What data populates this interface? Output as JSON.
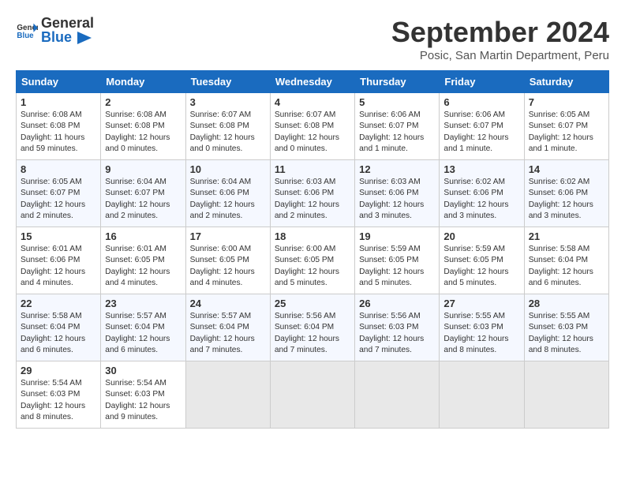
{
  "header": {
    "logo_general": "General",
    "logo_blue": "Blue",
    "month_title": "September 2024",
    "location": "Posic, San Martin Department, Peru"
  },
  "days_of_week": [
    "Sunday",
    "Monday",
    "Tuesday",
    "Wednesday",
    "Thursday",
    "Friday",
    "Saturday"
  ],
  "weeks": [
    [
      {
        "num": "1",
        "info": "Sunrise: 6:08 AM\nSunset: 6:08 PM\nDaylight: 11 hours\nand 59 minutes."
      },
      {
        "num": "2",
        "info": "Sunrise: 6:08 AM\nSunset: 6:08 PM\nDaylight: 12 hours\nand 0 minutes."
      },
      {
        "num": "3",
        "info": "Sunrise: 6:07 AM\nSunset: 6:08 PM\nDaylight: 12 hours\nand 0 minutes."
      },
      {
        "num": "4",
        "info": "Sunrise: 6:07 AM\nSunset: 6:08 PM\nDaylight: 12 hours\nand 0 minutes."
      },
      {
        "num": "5",
        "info": "Sunrise: 6:06 AM\nSunset: 6:07 PM\nDaylight: 12 hours\nand 1 minute."
      },
      {
        "num": "6",
        "info": "Sunrise: 6:06 AM\nSunset: 6:07 PM\nDaylight: 12 hours\nand 1 minute."
      },
      {
        "num": "7",
        "info": "Sunrise: 6:05 AM\nSunset: 6:07 PM\nDaylight: 12 hours\nand 1 minute."
      }
    ],
    [
      {
        "num": "8",
        "info": "Sunrise: 6:05 AM\nSunset: 6:07 PM\nDaylight: 12 hours\nand 2 minutes."
      },
      {
        "num": "9",
        "info": "Sunrise: 6:04 AM\nSunset: 6:07 PM\nDaylight: 12 hours\nand 2 minutes."
      },
      {
        "num": "10",
        "info": "Sunrise: 6:04 AM\nSunset: 6:06 PM\nDaylight: 12 hours\nand 2 minutes."
      },
      {
        "num": "11",
        "info": "Sunrise: 6:03 AM\nSunset: 6:06 PM\nDaylight: 12 hours\nand 2 minutes."
      },
      {
        "num": "12",
        "info": "Sunrise: 6:03 AM\nSunset: 6:06 PM\nDaylight: 12 hours\nand 3 minutes."
      },
      {
        "num": "13",
        "info": "Sunrise: 6:02 AM\nSunset: 6:06 PM\nDaylight: 12 hours\nand 3 minutes."
      },
      {
        "num": "14",
        "info": "Sunrise: 6:02 AM\nSunset: 6:06 PM\nDaylight: 12 hours\nand 3 minutes."
      }
    ],
    [
      {
        "num": "15",
        "info": "Sunrise: 6:01 AM\nSunset: 6:06 PM\nDaylight: 12 hours\nand 4 minutes."
      },
      {
        "num": "16",
        "info": "Sunrise: 6:01 AM\nSunset: 6:05 PM\nDaylight: 12 hours\nand 4 minutes."
      },
      {
        "num": "17",
        "info": "Sunrise: 6:00 AM\nSunset: 6:05 PM\nDaylight: 12 hours\nand 4 minutes."
      },
      {
        "num": "18",
        "info": "Sunrise: 6:00 AM\nSunset: 6:05 PM\nDaylight: 12 hours\nand 5 minutes."
      },
      {
        "num": "19",
        "info": "Sunrise: 5:59 AM\nSunset: 6:05 PM\nDaylight: 12 hours\nand 5 minutes."
      },
      {
        "num": "20",
        "info": "Sunrise: 5:59 AM\nSunset: 6:05 PM\nDaylight: 12 hours\nand 5 minutes."
      },
      {
        "num": "21",
        "info": "Sunrise: 5:58 AM\nSunset: 6:04 PM\nDaylight: 12 hours\nand 6 minutes."
      }
    ],
    [
      {
        "num": "22",
        "info": "Sunrise: 5:58 AM\nSunset: 6:04 PM\nDaylight: 12 hours\nand 6 minutes."
      },
      {
        "num": "23",
        "info": "Sunrise: 5:57 AM\nSunset: 6:04 PM\nDaylight: 12 hours\nand 6 minutes."
      },
      {
        "num": "24",
        "info": "Sunrise: 5:57 AM\nSunset: 6:04 PM\nDaylight: 12 hours\nand 7 minutes."
      },
      {
        "num": "25",
        "info": "Sunrise: 5:56 AM\nSunset: 6:04 PM\nDaylight: 12 hours\nand 7 minutes."
      },
      {
        "num": "26",
        "info": "Sunrise: 5:56 AM\nSunset: 6:03 PM\nDaylight: 12 hours\nand 7 minutes."
      },
      {
        "num": "27",
        "info": "Sunrise: 5:55 AM\nSunset: 6:03 PM\nDaylight: 12 hours\nand 8 minutes."
      },
      {
        "num": "28",
        "info": "Sunrise: 5:55 AM\nSunset: 6:03 PM\nDaylight: 12 hours\nand 8 minutes."
      }
    ],
    [
      {
        "num": "29",
        "info": "Sunrise: 5:54 AM\nSunset: 6:03 PM\nDaylight: 12 hours\nand 8 minutes."
      },
      {
        "num": "30",
        "info": "Sunrise: 5:54 AM\nSunset: 6:03 PM\nDaylight: 12 hours\nand 9 minutes."
      },
      {
        "num": "",
        "info": ""
      },
      {
        "num": "",
        "info": ""
      },
      {
        "num": "",
        "info": ""
      },
      {
        "num": "",
        "info": ""
      },
      {
        "num": "",
        "info": ""
      }
    ]
  ]
}
